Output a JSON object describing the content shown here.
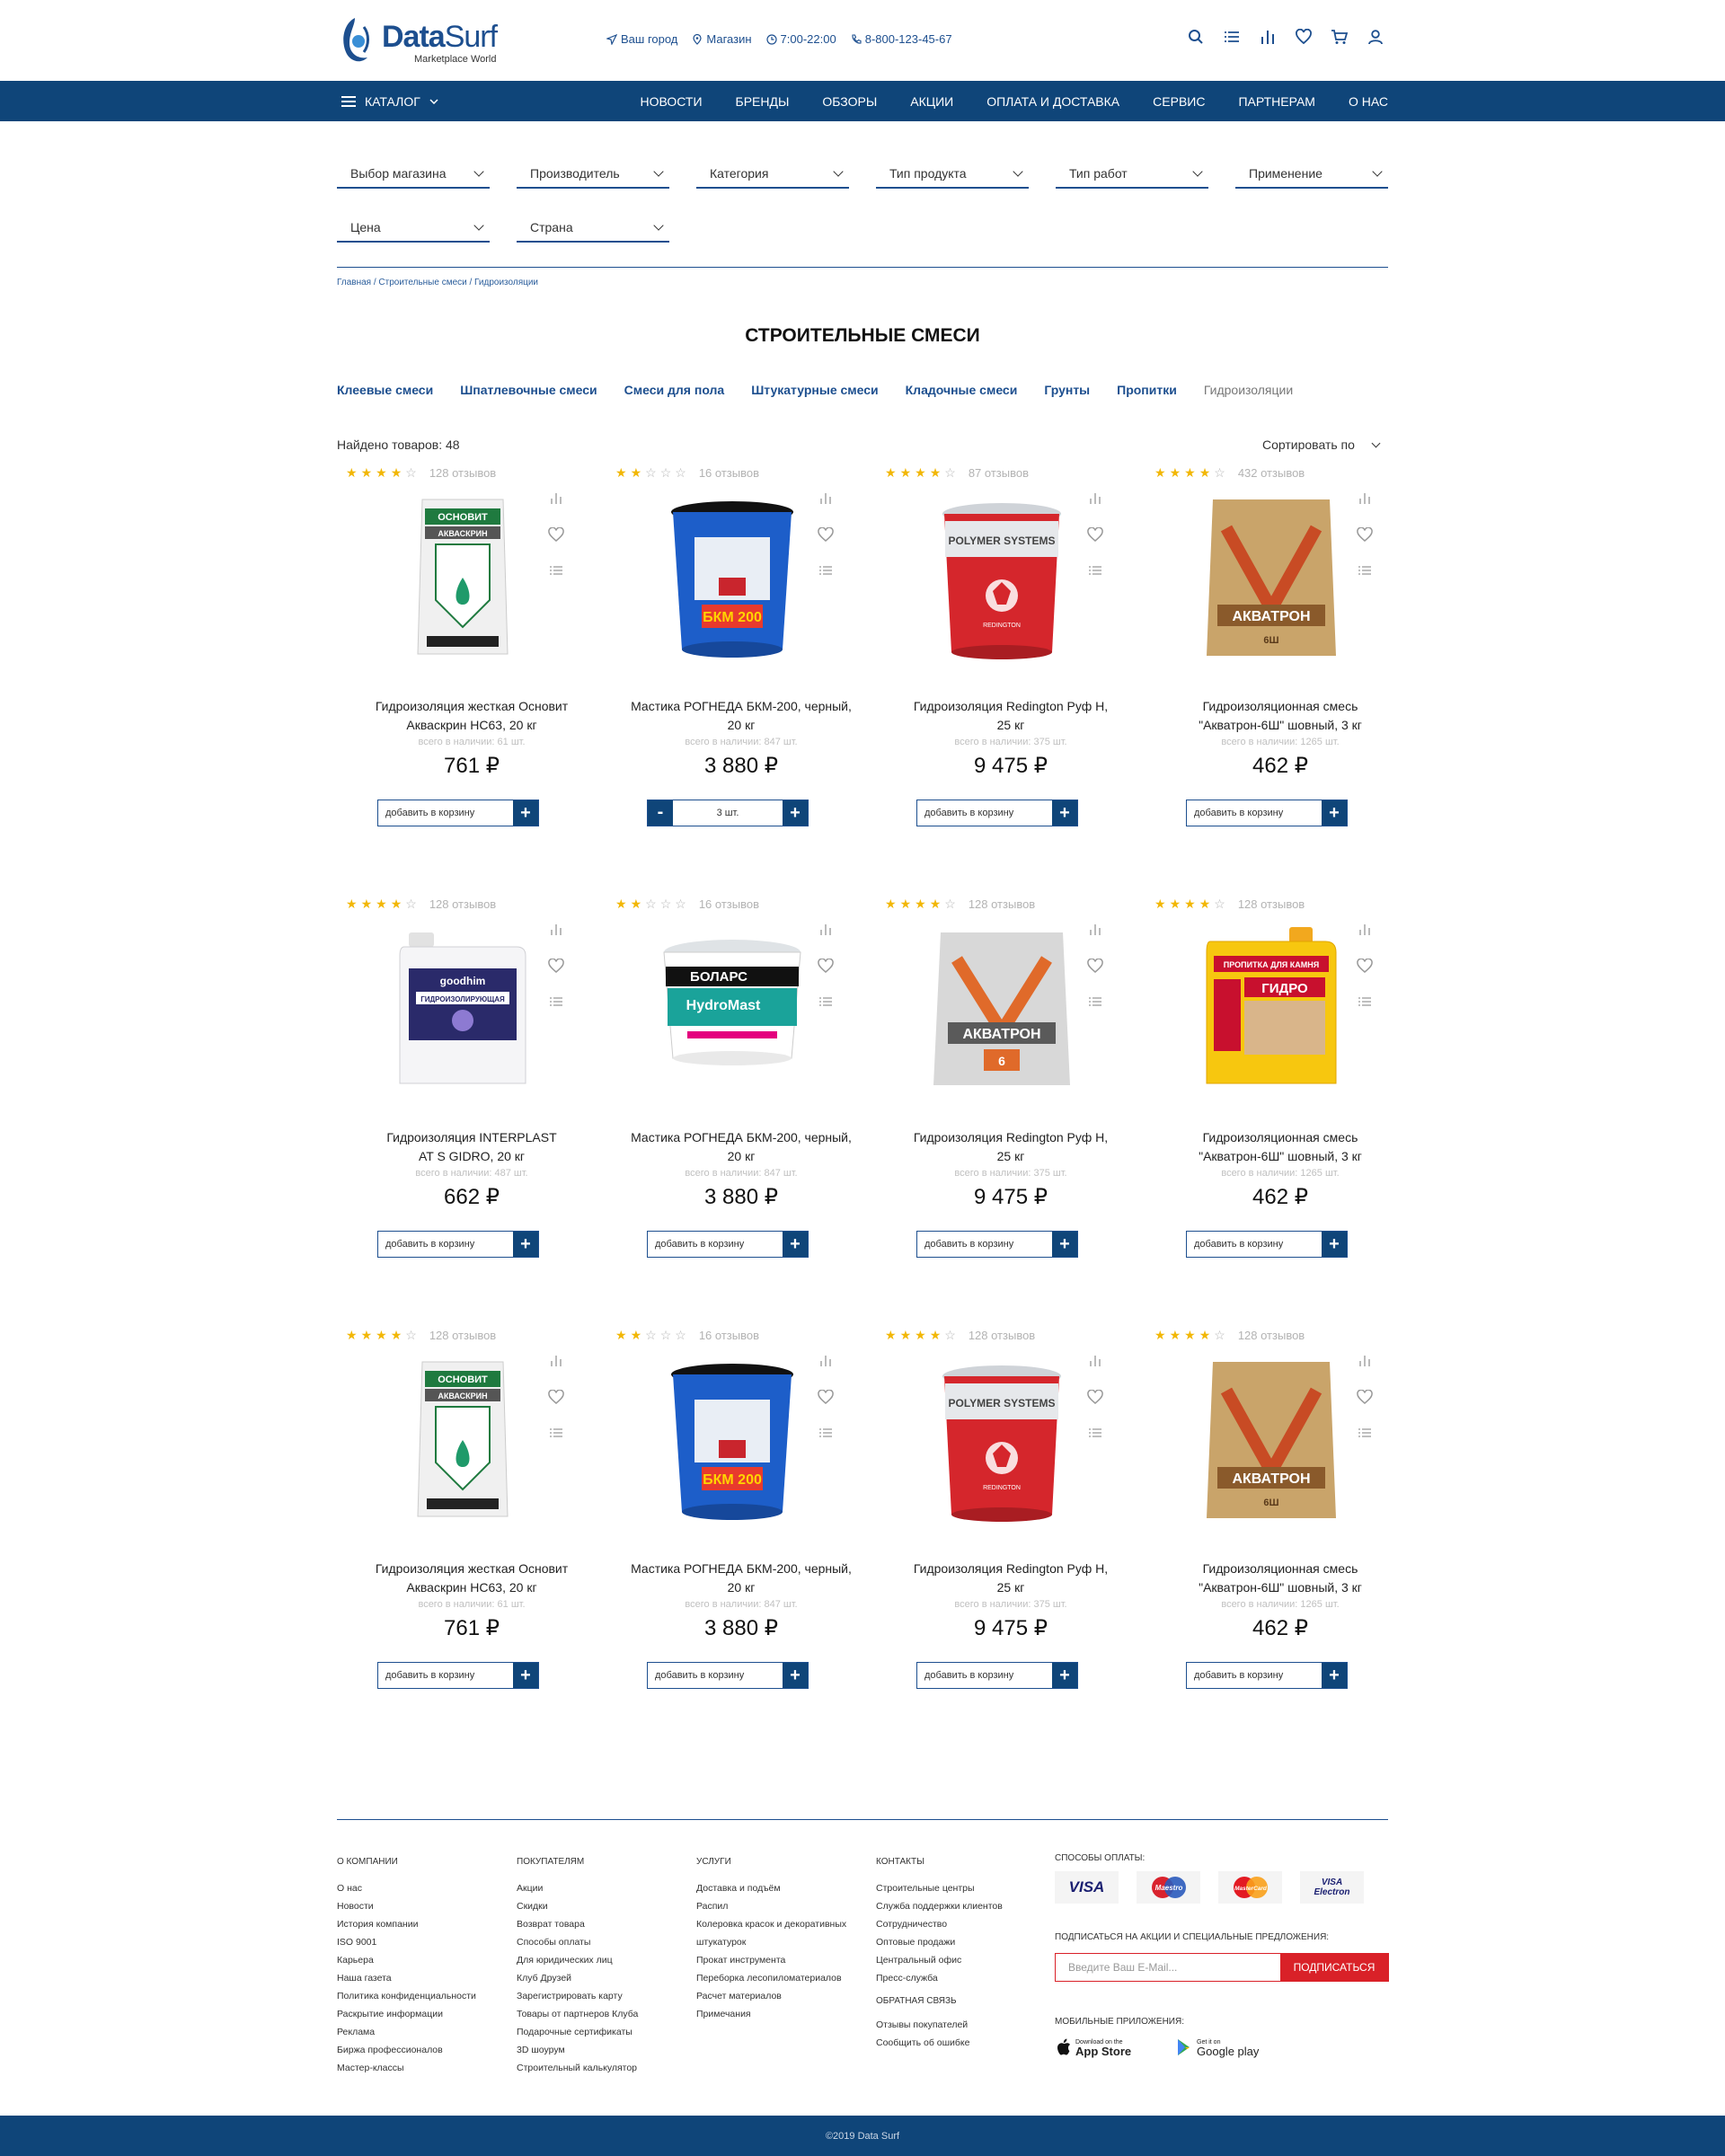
{
  "brand": {
    "name_bold": "Data",
    "name_light": "Surf",
    "tagline": "Marketplace World"
  },
  "header_info": [
    {
      "icon": "location-arrow-icon",
      "text": "Ваш город"
    },
    {
      "icon": "map-pin-icon",
      "text": "Магазин"
    },
    {
      "icon": "clock-icon",
      "text": "7:00-22:00"
    },
    {
      "icon": "phone-icon",
      "text": "8-800-123-45-67"
    }
  ],
  "header_icons": [
    "search-icon",
    "list-icon",
    "compare-chart-icon",
    "heart-icon",
    "cart-icon",
    "user-icon"
  ],
  "nav": {
    "catalog": "КАТАЛОГ",
    "items": [
      "Новости",
      "Бренды",
      "Обзоры",
      "Акции",
      "Оплата и доставка",
      "Сервис",
      "Партнерам",
      "О нас"
    ]
  },
  "filters": [
    "Выбор магазина",
    "Производитель",
    "Категория",
    "Тип продукта",
    "Тип работ",
    "Применение",
    "Цена",
    "Страна"
  ],
  "breadcrumb": "Главная / Строительные смеси / Гидроизоляции",
  "page_title": "СТРОИТЕЛЬНЫЕ СМЕСИ",
  "subcategories": [
    "Клеевые смеси",
    "Шпатлевочные смеси",
    "Смеси для пола",
    "Штукатурные смеси",
    "Кладочные смеси",
    "Грунты",
    "Пропитки",
    "Гидроизоляции"
  ],
  "found": "Найдено товаров: 48",
  "sort_label": "Сортировать по",
  "add_label": "добавить в корзину",
  "products": [
    {
      "rating": 4,
      "reviews": "128 отзывов",
      "name1": "Гидроизоляция жесткая Основит",
      "name2": "Акваскрин НС63, 20 кг",
      "stock": "всего в наличии: 61 шт.",
      "price": "761 ₽",
      "img": "bag-white",
      "qty": ""
    },
    {
      "rating": 2,
      "reviews": "16 отзывов",
      "name1": "Мастика РОГНЕДА БКМ-200, черный,",
      "name2": "20 кг",
      "stock": "всего в наличии: 847 шт.",
      "price": "3 880 ₽",
      "img": "bucket-blue",
      "qty": "3 шт."
    },
    {
      "rating": 4,
      "reviews": "87 отзывов",
      "name1": "Гидроизоляция Redington Руф Н,",
      "name2": "25 кг",
      "stock": "всего в наличии: 375 шт.",
      "price": "9 475 ₽",
      "img": "bucket-red",
      "qty": ""
    },
    {
      "rating": 4,
      "reviews": "432 отзывов",
      "name1": "Гидроизоляционная смесь",
      "name2": "\"Акватрон-6Ш\" шовный, 3 кг",
      "stock": "всего в наличии: 1265 шт.",
      "price": "462 ₽",
      "img": "bag-tan",
      "qty": ""
    },
    {
      "rating": 4,
      "reviews": "128 отзывов",
      "name1": "Гидроизоляция INTERPLAST",
      "name2": "AT S GIDRO,  20 кг",
      "stock": "всего в наличии: 487 шт.",
      "price": "662 ₽",
      "img": "canister-white",
      "qty": ""
    },
    {
      "rating": 2,
      "reviews": "16 отзывов",
      "name1": "Мастика РОГНЕДА БКМ-200, черный,",
      "name2": "20 кг",
      "stock": "всего в наличии: 847 шт.",
      "price": "3 880 ₽",
      "img": "bucket-teal",
      "qty": ""
    },
    {
      "rating": 4,
      "reviews": "128 отзывов",
      "name1": "Гидроизоляция Redington Руф Н,",
      "name2": "25 кг",
      "stock": "всего в наличии: 375 шт.",
      "price": "9 475 ₽",
      "img": "bag-grey",
      "qty": ""
    },
    {
      "rating": 4,
      "reviews": "128 отзывов",
      "name1": "Гидроизоляционная смесь",
      "name2": "\"Акватрон-6Ш\" шовный, 3 кг",
      "stock": "всего в наличии: 1265 шт.",
      "price": "462 ₽",
      "img": "canister-yellow",
      "qty": ""
    },
    {
      "rating": 4,
      "reviews": "128 отзывов",
      "name1": "Гидроизоляция жесткая Основит",
      "name2": "Акваскрин НС63, 20 кг",
      "stock": "всего в наличии: 61 шт.",
      "price": "761 ₽",
      "img": "bag-white",
      "qty": ""
    },
    {
      "rating": 2,
      "reviews": "16 отзывов",
      "name1": "Мастика РОГНЕДА БКМ-200, черный,",
      "name2": "20 кг",
      "stock": "всего в наличии: 847 шт.",
      "price": "3 880 ₽",
      "img": "bucket-blue",
      "qty": ""
    },
    {
      "rating": 4,
      "reviews": "128 отзывов",
      "name1": "Гидроизоляция Redington Руф Н,",
      "name2": "25 кг",
      "stock": "всего в наличии: 375 шт.",
      "price": "9 475 ₽",
      "img": "bucket-red",
      "qty": ""
    },
    {
      "rating": 4,
      "reviews": "128 отзывов",
      "name1": "Гидроизоляционная смесь",
      "name2": "\"Акватрон-6Ш\" шовный, 3 кг",
      "stock": "всего в наличии: 1265 шт.",
      "price": "462 ₽",
      "img": "bag-tan",
      "qty": ""
    }
  ],
  "product_labels": {
    "bag-white": [
      "ОСНОВИТ",
      "АКВАСКРИН"
    ],
    "bucket-blue": [
      "БКМ 200"
    ],
    "bucket-red": [
      "POLYMER SYSTEMS",
      "REDINGTON"
    ],
    "bag-tan": [
      "АКВАТРОН",
      "6Ш"
    ],
    "canister-white": [
      "goodhim",
      "ГИДРОИЗОЛИРУЮЩАЯ"
    ],
    "bucket-teal": [
      "БОЛАРС",
      "HydroMast"
    ],
    "bag-grey": [
      "АКВАТРОН",
      "6"
    ],
    "canister-yellow": [
      "ПРОПИТКА ДЛЯ КАМНЯ",
      "ГИДРО"
    ]
  },
  "footer": {
    "col1": {
      "title": "О компании",
      "items": [
        "О нас",
        "Новости",
        "История компании",
        "ISO 9001",
        "Карьера",
        "Наша газета",
        "Политика конфиденциальности",
        "Раскрытие информации",
        "Реклама",
        "Биржа профессионалов",
        "Мастер-классы"
      ]
    },
    "col2": {
      "title": "Покупателям",
      "items": [
        "Акции",
        "Скидки",
        "Возврат товара",
        "Способы оплаты",
        "Для юридических лиц",
        "Клуб Друзей",
        "Зарегистрировать карту",
        "Товары от партнеров Клуба",
        "Подарочные сертификаты",
        "3D шоурум",
        "Строительный калькулятор"
      ]
    },
    "col3": {
      "title": "Услуги",
      "items": [
        "Доставка и подъём",
        "Распил",
        "Колеровка красок и  декоративных",
        "штукатурок",
        "Прокат инструмента",
        "Переборка лесопиломатериалов",
        "Расчет материалов",
        "Примечания"
      ]
    },
    "col4": {
      "title": "Контакты",
      "items": [
        "Строительные центры",
        "Служба поддержки клиентов",
        "Сотрудничество",
        "Оптовые продажи",
        "Центральный офис",
        "Пресс-служба"
      ],
      "title2": "Обратная связь",
      "items2": [
        "Отзывы покупателей",
        "Сообщить об ошибке"
      ]
    },
    "payment_title": "Способы оплаты:",
    "payment_cards": [
      "VISA",
      "Maestro",
      "MasterCard",
      "VISA Electron"
    ],
    "subscribe_title": "Подписаться на акции и специальные предложения:",
    "subscribe_placeholder": "Введите Ваш E-Mail...",
    "subscribe_button": "Подписаться",
    "mobile_title": "Мобильные приложения:",
    "app_store_small": "Download on the",
    "app_store": "App Store",
    "google_small": "Get it on",
    "google_play": "Google play",
    "copyright": "©2019  Data Surf"
  },
  "colors": {
    "brand": "#0f4579",
    "accent_red": "#d92128",
    "star": "#f2b705"
  }
}
